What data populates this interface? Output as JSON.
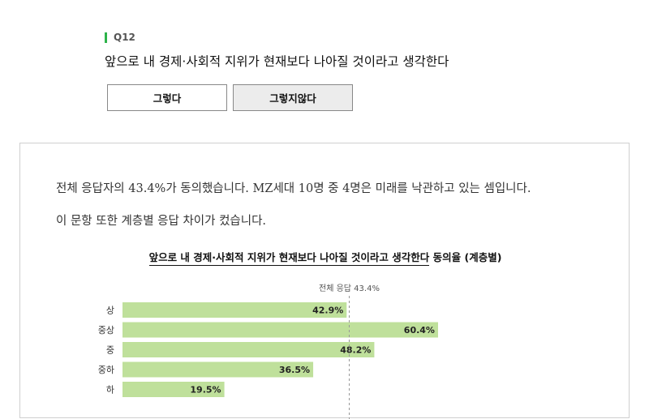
{
  "question": {
    "tag": "Q12",
    "text": "앞으로 내 경제·사회적 지위가 현재보다 나아질 것이라고 생각한다"
  },
  "buttons": {
    "yes": "그렇다",
    "no": "그렇지않다"
  },
  "summary": {
    "line1": "전체 응답자의 43.4%가 동의했습니다. MZ세대 10명 중 4명은 미래를 낙관하고 있는 셈입니다.",
    "line2": "이 문항 또한 계층별 응답 차이가 컸습니다."
  },
  "colors": {
    "accent": "#2db34a",
    "bar": "#bfe09b",
    "reference_line": "#999999"
  },
  "chart_data": {
    "type": "bar",
    "orientation": "horizontal",
    "title_main": "앞으로 내 경제·사회적 지위가 현재보다 나아질 것이라고 생각한다",
    "title_suffix": "동의율 (계층별)",
    "categories": [
      "상",
      "중상",
      "중",
      "중하",
      "하"
    ],
    "values": [
      42.9,
      60.4,
      48.2,
      36.5,
      19.5
    ],
    "value_labels": [
      "42.9%",
      "60.4%",
      "48.2%",
      "36.5%",
      "19.5%"
    ],
    "reference": {
      "value": 43.4,
      "label": "전체 응답 43.4%"
    },
    "xlim": [
      0,
      100
    ],
    "grid": false,
    "legend": "none"
  }
}
